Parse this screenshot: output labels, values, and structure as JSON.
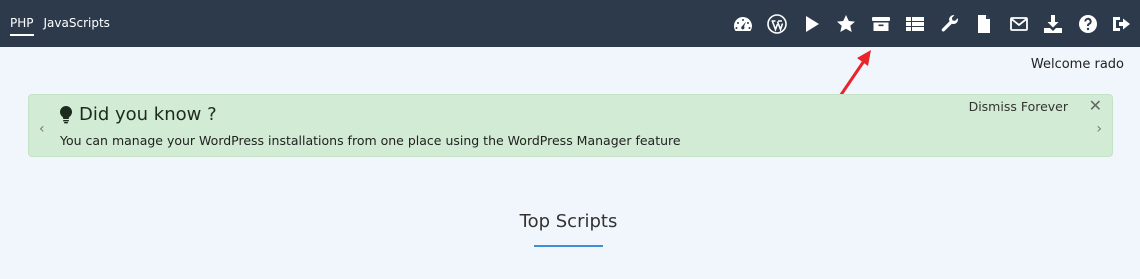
{
  "header": {
    "tabs": [
      {
        "label": "PHP",
        "active": true
      },
      {
        "label": "JavaScripts",
        "active": false
      }
    ],
    "icons": [
      "dashboard-icon",
      "wordpress-icon",
      "play-icon",
      "star-icon",
      "archive-icon",
      "list-icon",
      "wrench-icon",
      "file-icon",
      "mail-icon",
      "download-icon",
      "help-icon",
      "logout-icon"
    ]
  },
  "welcome": "Welcome rado",
  "notice": {
    "title": "Did you know ?",
    "text": "You can manage your WordPress installations from one place using the WordPress Manager feature",
    "dismiss_label": "Dismiss Forever",
    "close_glyph": "✕",
    "prev_glyph": "‹",
    "next_glyph": "›"
  },
  "section": {
    "title": "Top Scripts"
  },
  "colors": {
    "topbar": "#2c3a4b",
    "notice_bg": "#d2ebd4",
    "accent": "#3f8fd6",
    "arrow": "#e8252a"
  }
}
